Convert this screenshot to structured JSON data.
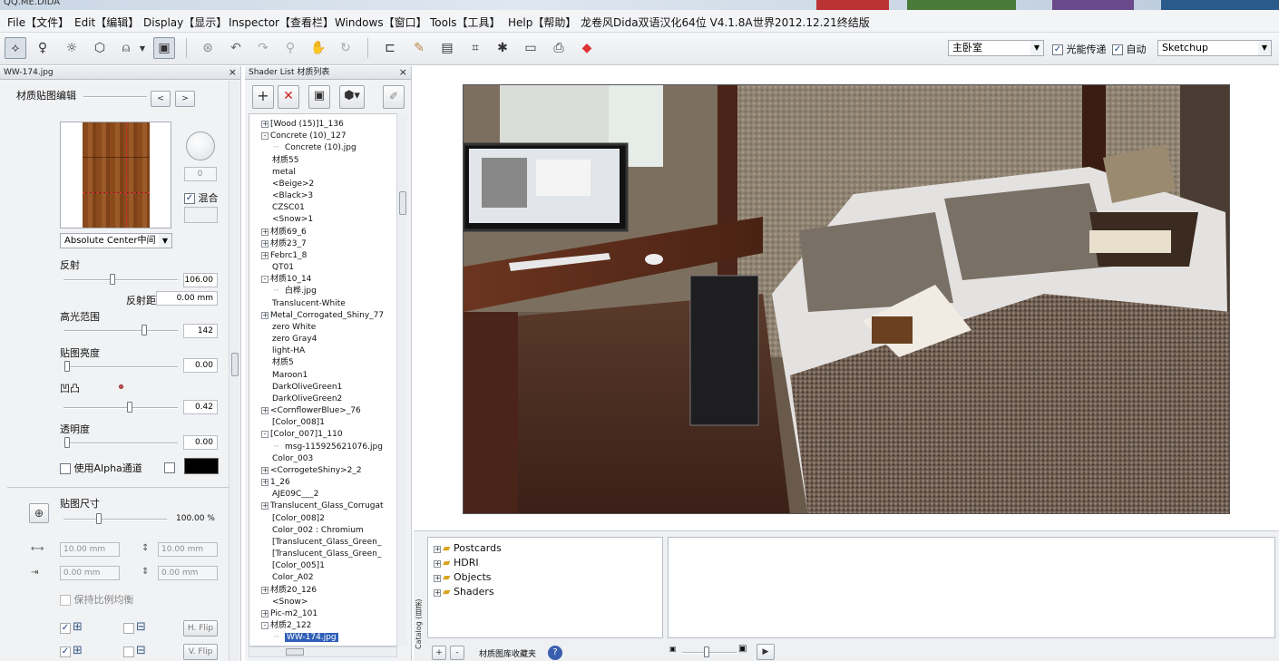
{
  "window": {
    "title": "QQ.ME.DIDA"
  },
  "menu": [
    {
      "label": "File【文件】"
    },
    {
      "label": "Edit【编辑】"
    },
    {
      "label": "Display【显示】"
    },
    {
      "label": "Inspector【查看栏】"
    },
    {
      "label": "Windows【窗口】"
    },
    {
      "label": "Tools【工具】"
    },
    {
      "label": "Help【帮助】"
    },
    {
      "label": "龙卷风Dida双语汉化64位 V4.1.8A"
    },
    {
      "label": "世界2012.12.21终结版"
    }
  ],
  "toolbar": {
    "scene_select": "主卧室",
    "check1_label": "光能传递",
    "check2_label": "自动",
    "engine_select": "Sketchup"
  },
  "left_panel": {
    "title": "WW-174.jpg",
    "section_title": "材质贴图编辑",
    "prev": "<",
    "next": ">",
    "small_value": "0",
    "mix_label": "混合",
    "projection": "Absolute Center中间",
    "reflect_label": "反射",
    "reflect_value": "106.00",
    "reflect_dist_label": "反射距",
    "reflect_dist_value": "0.00 mm",
    "highlight_label": "高光范围",
    "highlight_value": "142",
    "brightness_label": "贴图亮度",
    "brightness_value": "0.00",
    "bump_label": "凹凸",
    "bump_value": "0.42",
    "transparency_label": "透明度",
    "transparency_value": "0.00",
    "alpha_label": "使用Alpha通道",
    "size_label": "贴图尺寸",
    "size_value": "100.00 %",
    "w1": "10.00 mm",
    "w2": "10.00 mm",
    "o1": "0.00 mm",
    "o2": "0.00 mm",
    "keep_ratio": "保持比例均衡",
    "hflip": "H. Flip",
    "vflip": "V. Flip"
  },
  "shader_list": {
    "title": "Shader List 材质列表",
    "items": [
      {
        "text": "[Wood (15)]1_136",
        "indent": 0,
        "box": "+"
      },
      {
        "text": "Concrete (10)_127",
        "indent": 0,
        "box": "-"
      },
      {
        "text": "Concrete (10).jpg",
        "indent": 1,
        "box": ""
      },
      {
        "text": "材质55",
        "indent": 0,
        "box": ""
      },
      {
        "text": "metal",
        "indent": 0,
        "box": ""
      },
      {
        "text": "<Beige>2",
        "indent": 0,
        "box": ""
      },
      {
        "text": "<Black>3",
        "indent": 0,
        "box": ""
      },
      {
        "text": "CZSC01",
        "indent": 0,
        "box": ""
      },
      {
        "text": "<Snow>1",
        "indent": 0,
        "box": ""
      },
      {
        "text": "材质69_6",
        "indent": 0,
        "box": "+"
      },
      {
        "text": "材质23_7",
        "indent": 0,
        "box": "+"
      },
      {
        "text": "Febrc1_8",
        "indent": 0,
        "box": "+"
      },
      {
        "text": "QT01",
        "indent": 0,
        "box": ""
      },
      {
        "text": "材质10_14",
        "indent": 0,
        "box": "-"
      },
      {
        "text": "白桦.jpg",
        "indent": 1,
        "box": ""
      },
      {
        "text": "Translucent-White",
        "indent": 0,
        "box": ""
      },
      {
        "text": "Metal_Corrogated_Shiny_77",
        "indent": 0,
        "box": "+"
      },
      {
        "text": "zero White",
        "indent": 0,
        "box": ""
      },
      {
        "text": "zero Gray4",
        "indent": 0,
        "box": ""
      },
      {
        "text": "light-HA",
        "indent": 0,
        "box": ""
      },
      {
        "text": "材质5",
        "indent": 0,
        "box": ""
      },
      {
        "text": "Maroon1",
        "indent": 0,
        "box": ""
      },
      {
        "text": "DarkOliveGreen1",
        "indent": 0,
        "box": ""
      },
      {
        "text": "DarkOliveGreen2",
        "indent": 0,
        "box": ""
      },
      {
        "text": "<CornflowerBlue>_76",
        "indent": 0,
        "box": "+"
      },
      {
        "text": "[Color_008]1",
        "indent": 0,
        "box": ""
      },
      {
        "text": "[Color_007]1_110",
        "indent": 0,
        "box": "-"
      },
      {
        "text": "msg-115925621076.jpg",
        "indent": 1,
        "box": ""
      },
      {
        "text": "Color_003",
        "indent": 0,
        "box": ""
      },
      {
        "text": "<CorrogeteShiny>2_2",
        "indent": 0,
        "box": "+"
      },
      {
        "text": "1_26",
        "indent": 0,
        "box": "+"
      },
      {
        "text": "AJE09C___2",
        "indent": 0,
        "box": ""
      },
      {
        "text": "Translucent_Glass_Corrugat",
        "indent": 0,
        "box": "+"
      },
      {
        "text": "[Color_008]2",
        "indent": 0,
        "box": ""
      },
      {
        "text": "Color_002 : Chromium",
        "indent": 0,
        "box": ""
      },
      {
        "text": "[Translucent_Glass_Green_",
        "indent": 0,
        "box": ""
      },
      {
        "text": "[Translucent_Glass_Green_",
        "indent": 0,
        "box": ""
      },
      {
        "text": "[Color_005]1",
        "indent": 0,
        "box": ""
      },
      {
        "text": "Color_A02",
        "indent": 0,
        "box": ""
      },
      {
        "text": "材质20_126",
        "indent": 0,
        "box": "+"
      },
      {
        "text": "<Snow>",
        "indent": 0,
        "box": ""
      },
      {
        "text": "Pic-m2_101",
        "indent": 0,
        "box": "+"
      },
      {
        "text": "材质2_122",
        "indent": 0,
        "box": "-"
      },
      {
        "text": "WW-174.jpg",
        "indent": 1,
        "box": "",
        "selected": true
      }
    ]
  },
  "catalog": {
    "side_label": "Catalog (目录)",
    "items": [
      "Postcards",
      "HDRI",
      "Objects",
      "Shaders"
    ],
    "footer_label": "材质图库收藏夹",
    "add": "+",
    "remove": "-"
  }
}
